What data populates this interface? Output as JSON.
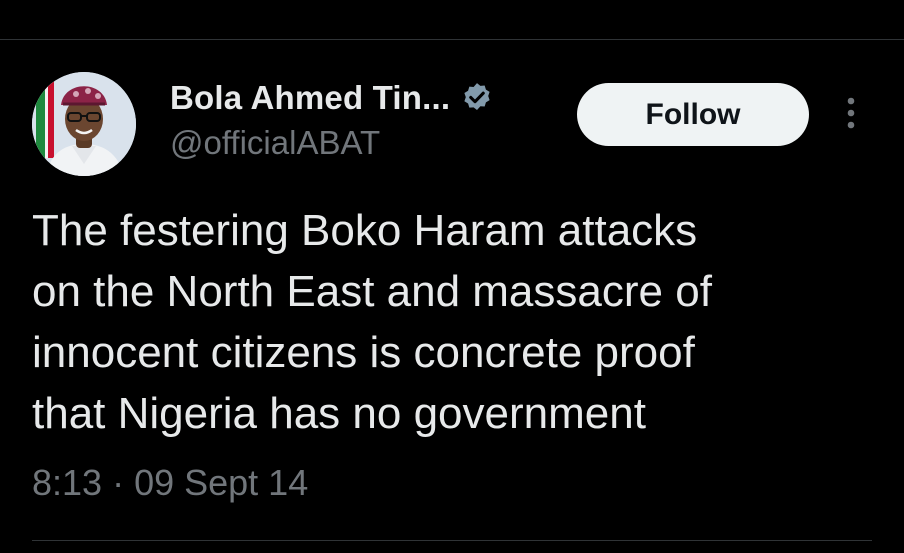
{
  "tweet": {
    "author": {
      "display_name": "Bola Ahmed Tin...",
      "handle": "@officialABAT",
      "verified": true,
      "avatar_icon": "profile-photo"
    },
    "follow_label": "Follow",
    "more_icon": "more-vertical-icon",
    "text_lines": [
      "The festering Boko Haram attacks",
      "on the North East and massacre of",
      "innocent citizens is concrete proof",
      "that Nigeria has no government"
    ],
    "time": "8:13",
    "separator": "·",
    "date": "09 Sept 14"
  },
  "colors": {
    "background": "#000000",
    "primary_text": "#e7e9ea",
    "secondary_text": "#71767b",
    "button_bg": "#eff3f4",
    "button_text": "#0f1419",
    "divider": "#2f3336",
    "verified_badge": "#829aab"
  }
}
